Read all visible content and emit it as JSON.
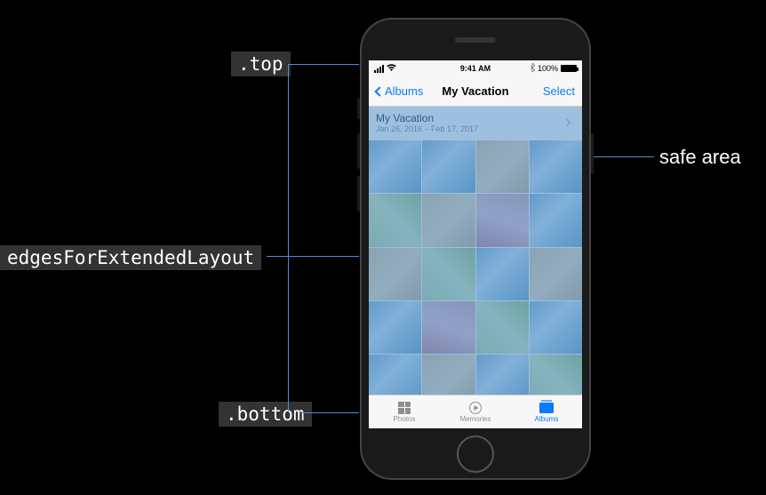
{
  "labels": {
    "top": ".top",
    "bottom": ".bottom",
    "edges": "edgesForExtendedLayout",
    "safearea": "safe area"
  },
  "statusbar": {
    "time": "9:41 AM",
    "carrier_icon": "wifi",
    "battery_pct": "100%"
  },
  "navbar": {
    "back_label": "Albums",
    "title": "My Vacation",
    "action_label": "Select"
  },
  "section": {
    "title": "My Vacation",
    "subtitle": "Jan 26, 2016 – Feb 17, 2017"
  },
  "tabs": [
    {
      "label": "Photos",
      "active": false
    },
    {
      "label": "Memories",
      "active": false
    },
    {
      "label": "Albums",
      "active": true
    }
  ]
}
